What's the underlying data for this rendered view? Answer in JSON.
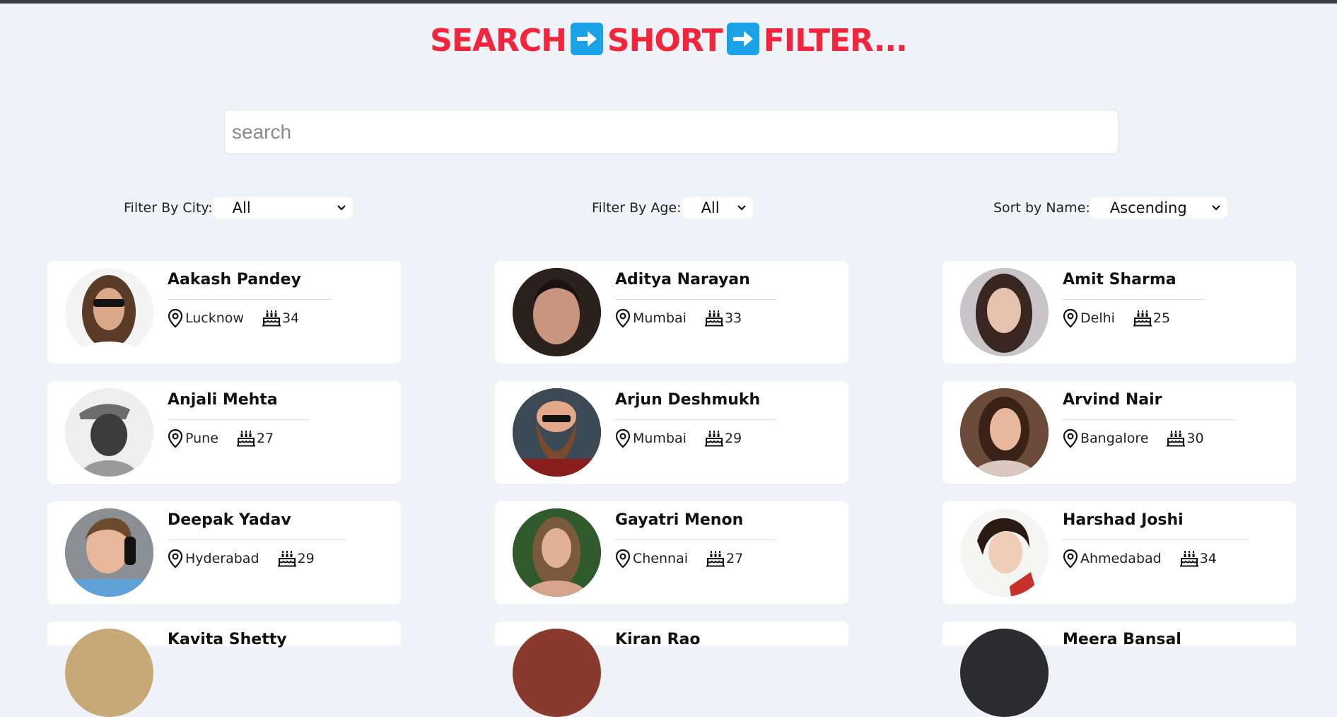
{
  "title": {
    "part1": "SEARCH",
    "part2": "SHORT",
    "part3": "FILTER..."
  },
  "search": {
    "placeholder": "search",
    "value": ""
  },
  "filters": {
    "city": {
      "label": "Filter By City:",
      "selected": "All"
    },
    "age": {
      "label": "Filter By Age:",
      "selected": "All"
    },
    "sort": {
      "label": "Sort by Name:",
      "selected": "Ascending"
    }
  },
  "icons": {
    "location": "location-pin-icon",
    "age": "birthday-cake-icon",
    "arrow": "right-arrow-icon",
    "dropdown": "chevron-down-icon"
  },
  "colors": {
    "title": "#f3253c",
    "arrow_box": "#1aa1e8",
    "background": "#eff2f7",
    "card": "#ffffff"
  },
  "people": [
    {
      "name": "Aakash Pandey",
      "city": "Lucknow",
      "age": "34"
    },
    {
      "name": "Aditya Narayan",
      "city": "Mumbai",
      "age": "33"
    },
    {
      "name": "Amit Sharma",
      "city": "Delhi",
      "age": "25"
    },
    {
      "name": "Anjali Mehta",
      "city": "Pune",
      "age": "27"
    },
    {
      "name": "Arjun Deshmukh",
      "city": "Mumbai",
      "age": "29"
    },
    {
      "name": "Arvind Nair",
      "city": "Bangalore",
      "age": "30"
    },
    {
      "name": "Deepak Yadav",
      "city": "Hyderabad",
      "age": "29"
    },
    {
      "name": "Gayatri Menon",
      "city": "Chennai",
      "age": "27"
    },
    {
      "name": "Harshad Joshi",
      "city": "Ahmedabad",
      "age": "34"
    },
    {
      "name": "Kavita Shetty",
      "city": "",
      "age": ""
    },
    {
      "name": "Kiran Rao",
      "city": "",
      "age": ""
    },
    {
      "name": "Meera Bansal",
      "city": "",
      "age": ""
    }
  ]
}
